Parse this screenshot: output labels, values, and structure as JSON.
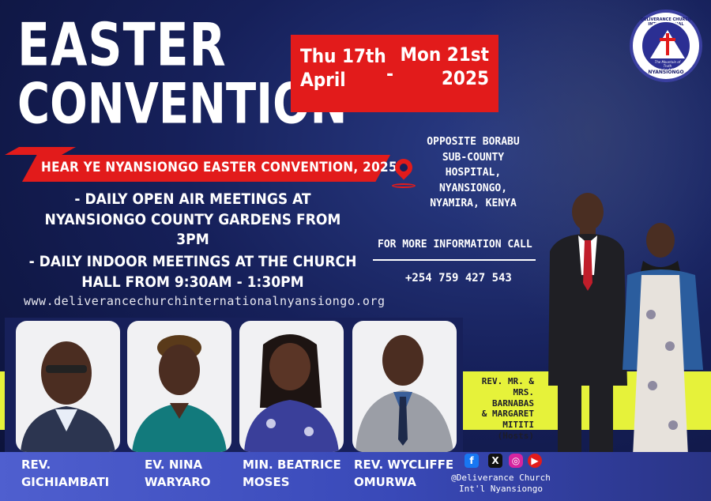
{
  "title": {
    "line1": "EASTER",
    "line2": "CONVENTION"
  },
  "dates": {
    "start_line1": "Thu 17th",
    "start_line2": "April",
    "separator": "-",
    "end_line1": "Mon 21st",
    "end_line2": "2025"
  },
  "logo": {
    "ring_text": "DELIVERANCE CHURCH INTERNATIONAL",
    "motto": "The Mountain of Truth",
    "verse": "Luke 4:18",
    "place": "NYANSIONGO"
  },
  "banner": "HEAR YE NYANSIONGO EASTER CONVENTION, 2025",
  "meetings": [
    "- DAILY OPEN AIR MEETINGS AT NYANSIONGO COUNTY GARDENS FROM 3PM",
    "- DAILY INDOOR MEETINGS AT THE CHURCH HALL FROM 9:30AM - 1:30PM"
  ],
  "website": "www.deliverancechurchinternationalnyansiongo.org",
  "address": [
    "OPPOSITE BORABU",
    "SUB-COUNTY",
    "HOSPITAL,",
    "NYANSIONGO,",
    "NYAMIRA, KENYA"
  ],
  "info": {
    "label": "FOR MORE INFORMATION CALL",
    "phone": "+254 759 427 543"
  },
  "hosts": [
    "REV. MR. &",
    "MRS. BARNABAS",
    "& MARGARET",
    "MITITI (Hosts)"
  ],
  "speakers": [
    {
      "line1": "REV.",
      "line2": "GICHIAMBATI"
    },
    {
      "line1": "EV. NINA",
      "line2": "WARYARO"
    },
    {
      "line1": "MIN. BEATRICE",
      "line2": "MOSES"
    },
    {
      "line1": "REV. WYCLIFFE",
      "line2": "OMURWA"
    }
  ],
  "social": {
    "icons": [
      "facebook-icon",
      "x-icon",
      "instagram-icon",
      "youtube-icon"
    ],
    "handle_line1": "@Deliverance Church",
    "handle_line2": "Int'l Nyansiongo"
  },
  "colors": {
    "accent_red": "#e21b1b",
    "background_navy": "#16205a",
    "highlight_yellow": "#e6f23a",
    "name_strip_blue": "#3949b8"
  }
}
